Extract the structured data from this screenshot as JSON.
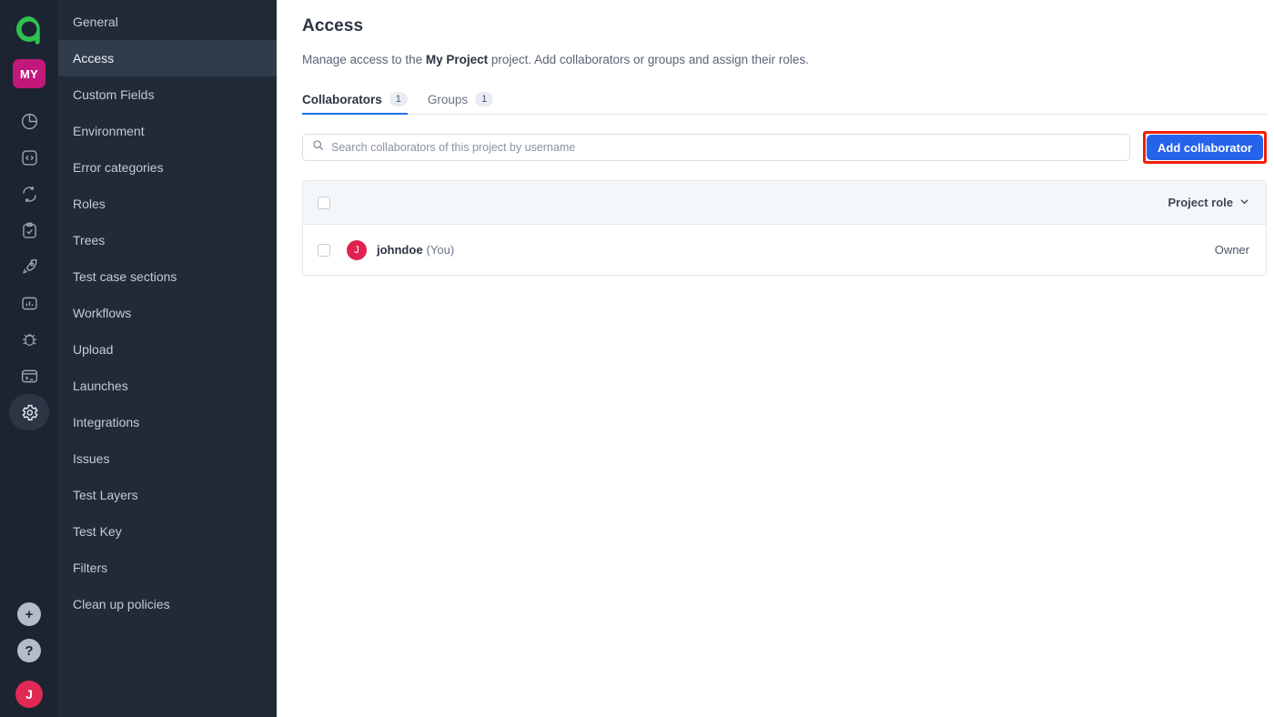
{
  "rail": {
    "logo": "allure-logo",
    "project_badge": "MY",
    "icons": [
      {
        "name": "dashboards-icon",
        "active": false
      },
      {
        "name": "code-icon",
        "active": false
      },
      {
        "name": "sync-icon",
        "active": false
      },
      {
        "name": "test-cases-icon",
        "active": false
      },
      {
        "name": "launches-rocket-icon",
        "active": false
      },
      {
        "name": "analytics-bar-icon",
        "active": false
      },
      {
        "name": "defects-bug-icon",
        "active": false
      },
      {
        "name": "terminal-icon",
        "active": false
      },
      {
        "name": "settings-gear-icon",
        "active": true
      }
    ],
    "bottom": {
      "add": "+",
      "help": "?",
      "avatar_initial": "J"
    }
  },
  "sidebar": {
    "items": [
      {
        "label": "General",
        "active": false
      },
      {
        "label": "Access",
        "active": true
      },
      {
        "label": "Custom Fields",
        "active": false
      },
      {
        "label": "Environment",
        "active": false
      },
      {
        "label": "Error categories",
        "active": false
      },
      {
        "label": "Roles",
        "active": false
      },
      {
        "label": "Trees",
        "active": false
      },
      {
        "label": "Test case sections",
        "active": false
      },
      {
        "label": "Workflows",
        "active": false
      },
      {
        "label": "Upload",
        "active": false
      },
      {
        "label": "Launches",
        "active": false
      },
      {
        "label": "Integrations",
        "active": false
      },
      {
        "label": "Issues",
        "active": false
      },
      {
        "label": "Test Layers",
        "active": false
      },
      {
        "label": "Test Key",
        "active": false
      },
      {
        "label": "Filters",
        "active": false
      },
      {
        "label": "Clean up policies",
        "active": false
      }
    ]
  },
  "main": {
    "title": "Access",
    "description_before": "Manage access to the ",
    "description_project": "My Project",
    "description_after": " project. Add collaborators or groups and assign their roles.",
    "tabs": [
      {
        "label": "Collaborators",
        "count": "1",
        "active": true
      },
      {
        "label": "Groups",
        "count": "1",
        "active": false
      }
    ],
    "search": {
      "placeholder": "Search collaborators of this project by username",
      "value": ""
    },
    "add_button": {
      "label": "Add collaborator",
      "highlight_color": "#f01f00",
      "background_color": "#2563eb"
    },
    "table": {
      "header": {
        "role_column": "Project role"
      },
      "rows": [
        {
          "avatar_initial": "J",
          "username": "johndoe",
          "you_label": "(You)",
          "role": "Owner"
        }
      ]
    }
  }
}
